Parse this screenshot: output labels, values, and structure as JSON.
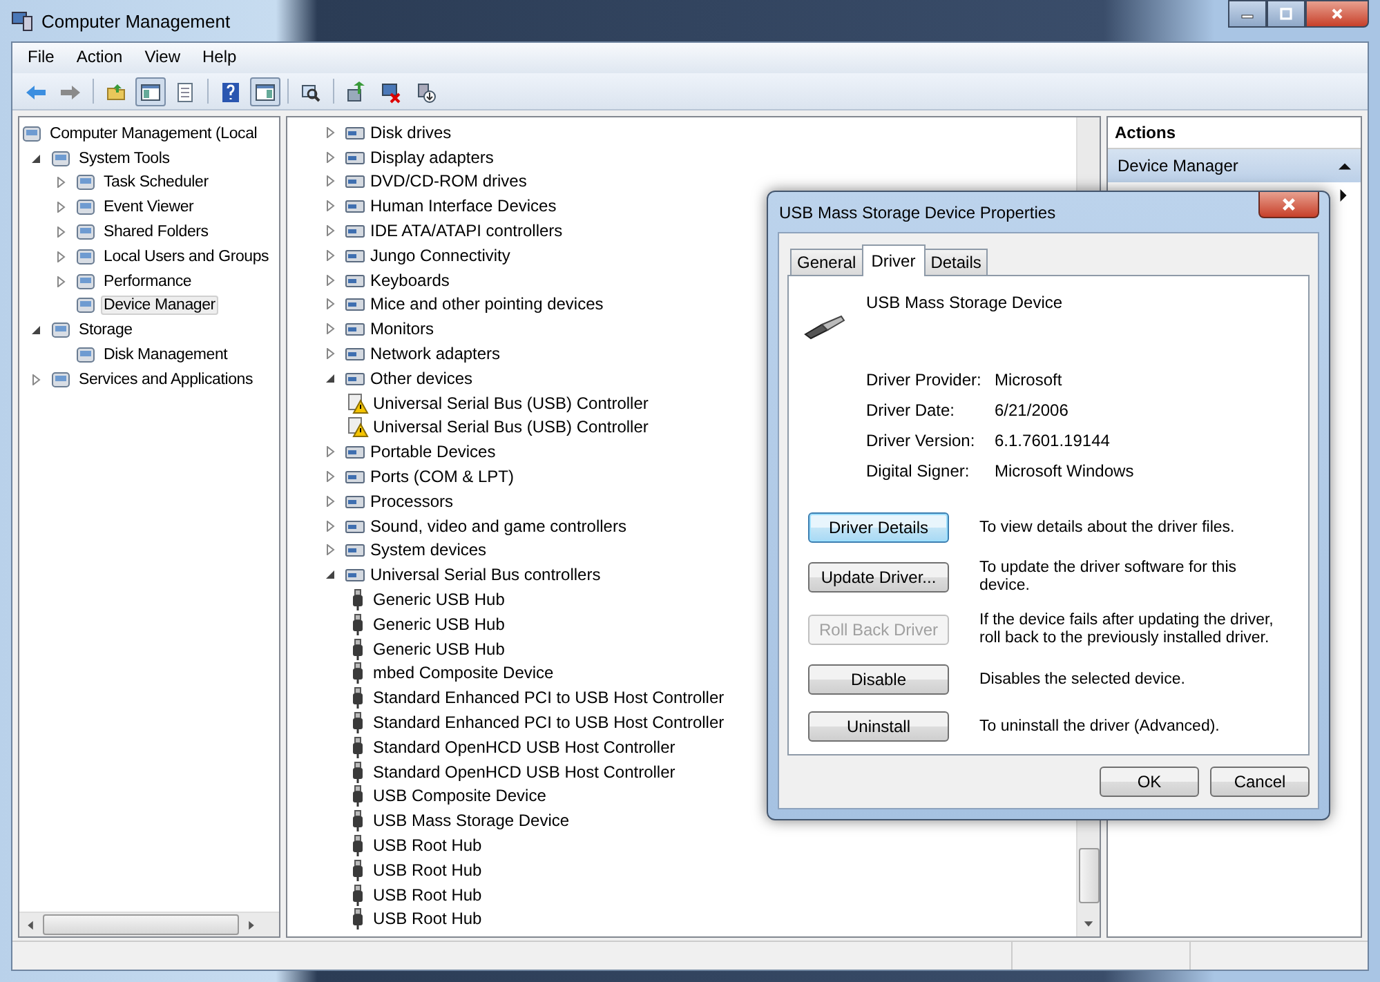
{
  "window": {
    "title": "Computer Management"
  },
  "menu": [
    "File",
    "Action",
    "View",
    "Help"
  ],
  "toolbar": [
    {
      "pressed": false
    },
    {
      "pressed": false
    },
    {
      "pressed": false
    },
    {
      "pressed": true
    },
    {
      "pressed": false
    },
    {
      "pressed": false
    },
    {
      "pressed": true
    },
    {
      "pressed": false
    },
    {
      "pressed": false
    },
    {
      "pressed": false
    },
    {
      "pressed": false
    }
  ],
  "nav_tree": [
    {
      "label": "Computer Management (Local",
      "selected": false,
      "children": [
        {
          "label": "System Tools",
          "expanded": true,
          "selected": false,
          "children": [
            {
              "label": "Task Scheduler",
              "expanded": false,
              "selected": false
            },
            {
              "label": "Event Viewer",
              "expanded": false,
              "selected": false
            },
            {
              "label": "Shared Folders",
              "expanded": false,
              "selected": false
            },
            {
              "label": "Local Users and Groups",
              "expanded": false,
              "selected": false
            },
            {
              "label": "Performance",
              "expanded": false,
              "selected": false
            },
            {
              "label": "Device Manager",
              "selected": true
            }
          ]
        },
        {
          "label": "Storage",
          "expanded": true,
          "selected": false,
          "children": [
            {
              "label": "Disk Management",
              "selected": false
            }
          ]
        },
        {
          "label": "Services and Applications",
          "expanded": false,
          "selected": false
        }
      ]
    }
  ],
  "device_tree": [
    {
      "label": "Disk drives",
      "expanded": false
    },
    {
      "label": "Display adapters",
      "expanded": false
    },
    {
      "label": "DVD/CD-ROM drives",
      "expanded": false
    },
    {
      "label": "Human Interface Devices",
      "expanded": false
    },
    {
      "label": "IDE ATA/ATAPI controllers",
      "expanded": false
    },
    {
      "label": "Jungo Connectivity",
      "expanded": false
    },
    {
      "label": "Keyboards",
      "expanded": false
    },
    {
      "label": "Mice and other pointing devices",
      "expanded": false
    },
    {
      "label": "Monitors",
      "expanded": false
    },
    {
      "label": "Network adapters",
      "expanded": false
    },
    {
      "label": "Other devices",
      "expanded": true,
      "children": [
        {
          "label": "Universal Serial Bus (USB) Controller",
          "kind": "warning"
        },
        {
          "label": "Universal Serial Bus (USB) Controller",
          "kind": "warning"
        }
      ]
    },
    {
      "label": "Portable Devices",
      "expanded": false
    },
    {
      "label": "Ports (COM & LPT)",
      "expanded": false
    },
    {
      "label": "Processors",
      "expanded": false
    },
    {
      "label": "Sound, video and game controllers",
      "expanded": false
    },
    {
      "label": "System devices",
      "expanded": false
    },
    {
      "label": "Universal Serial Bus controllers",
      "expanded": true,
      "children": [
        {
          "label": "Generic USB Hub",
          "kind": "usb"
        },
        {
          "label": "Generic USB Hub",
          "kind": "usb"
        },
        {
          "label": "Generic USB Hub",
          "kind": "usb"
        },
        {
          "label": "mbed Composite Device",
          "kind": "usb"
        },
        {
          "label": "Standard Enhanced PCI to USB Host Controller",
          "kind": "usb"
        },
        {
          "label": "Standard Enhanced PCI to USB Host Controller",
          "kind": "usb"
        },
        {
          "label": "Standard OpenHCD USB Host Controller",
          "kind": "usb"
        },
        {
          "label": "Standard OpenHCD USB Host Controller",
          "kind": "usb"
        },
        {
          "label": "USB Composite Device",
          "kind": "usb"
        },
        {
          "label": "USB Mass Storage Device",
          "kind": "usb"
        },
        {
          "label": "USB Root Hub",
          "kind": "usb"
        },
        {
          "label": "USB Root Hub",
          "kind": "usb"
        },
        {
          "label": "USB Root Hub",
          "kind": "usb"
        },
        {
          "label": "USB Root Hub",
          "kind": "usb"
        }
      ]
    }
  ],
  "actions": {
    "title": "Actions",
    "section": "Device Manager"
  },
  "dialog": {
    "title": "USB Mass Storage Device Properties",
    "tabs": [
      {
        "label": "General",
        "selected": false
      },
      {
        "label": "Driver",
        "selected": true
      },
      {
        "label": "Details",
        "selected": false
      }
    ],
    "device_name": "USB Mass Storage Device",
    "properties": [
      {
        "label": "Driver Provider:",
        "value": "Microsoft"
      },
      {
        "label": "Driver Date:",
        "value": "6/21/2006"
      },
      {
        "label": "Driver Version:",
        "value": "6.1.7601.19144"
      },
      {
        "label": "Digital Signer:",
        "value": "Microsoft Windows"
      }
    ],
    "buttons": [
      {
        "label": "Driver Details",
        "disabled": false,
        "focused": true,
        "description": "To view details about the driver files."
      },
      {
        "label": "Update Driver...",
        "disabled": false,
        "focused": false,
        "description": "To update the driver software for this device."
      },
      {
        "label": "Roll Back Driver",
        "disabled": true,
        "focused": false,
        "description": "If the device fails after updating the driver, roll back to the previously installed driver."
      },
      {
        "label": "Disable",
        "disabled": false,
        "focused": false,
        "description": "Disables the selected device."
      },
      {
        "label": "Uninstall",
        "disabled": false,
        "focused": false,
        "description": "To uninstall the driver (Advanced)."
      }
    ],
    "footer_buttons": [
      "OK",
      "Cancel"
    ]
  }
}
